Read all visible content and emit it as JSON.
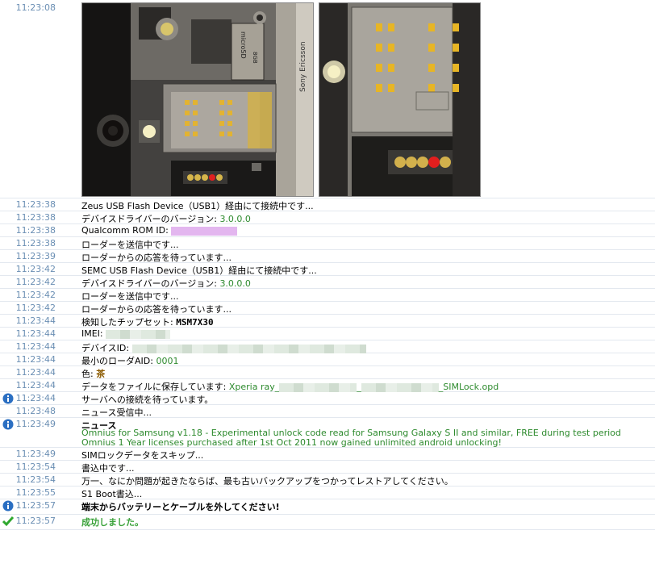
{
  "first_row": {
    "time": "11:23:08"
  },
  "photos": [
    {
      "name": "phone-sim-slot-photo"
    },
    {
      "name": "sim-slot-closeup-photo"
    }
  ],
  "photo_text": {
    "brand": "Sony Ericsson",
    "micro_sd": "microSD",
    "sd_size": "8GB"
  },
  "log": [
    {
      "time": "11:23:38",
      "text": "Zeus USB Flash Device（USB1）経由にて接続中です..."
    },
    {
      "time": "11:23:38",
      "label": "デバイスドライバーのバージョン: ",
      "value": "3.0.0.0"
    },
    {
      "time": "11:23:38",
      "label": "Qualcomm ROM ID: "
    },
    {
      "time": "11:23:38",
      "text": "ローダーを送信中です..."
    },
    {
      "time": "11:23:39",
      "text": "ローダーからの応答を待っています..."
    },
    {
      "time": "11:23:42",
      "text": "SEMC USB Flash Device（USB1）経由にて接続中です..."
    },
    {
      "time": "11:23:42",
      "label": "デバイスドライバーのバージョン: ",
      "value": "3.0.0.0"
    },
    {
      "time": "11:23:42",
      "text": "ローダーを送信中です..."
    },
    {
      "time": "11:23:42",
      "text": "ローダーからの応答を待っています..."
    },
    {
      "time": "11:23:44",
      "label": "検知したチップセット: ",
      "value": "MSM7X30"
    },
    {
      "time": "11:23:44",
      "label": "IMEI: "
    },
    {
      "time": "11:23:44",
      "label": "デバイスID: "
    },
    {
      "time": "11:23:44",
      "label": "最小のローダAID: ",
      "value": "0001"
    },
    {
      "time": "11:23:44",
      "label": "色: ",
      "value": "茶"
    },
    {
      "time": "11:23:44",
      "label": "データをファイルに保存しています: ",
      "value": "Xperia ray_",
      "value_end": "_SIMLock.opd"
    },
    {
      "time": "11:23:44",
      "text": "サーバへの接続を待っています。",
      "icon": "info-icon"
    },
    {
      "time": "11:23:48",
      "text": "ニュース受信中..."
    },
    {
      "time": "11:23:49",
      "title": "ニュース",
      "line1": "Omnius for Samsung v1.18 - Experimental unlock code read for Samsung Galaxy S II and similar, FREE during test period",
      "line2": "Omnius 1 Year licenses purchased after 1st Oct 2011 now gained unlimited android unlocking!",
      "icon": "info-icon"
    },
    {
      "time": "11:23:49",
      "text": "SIMロックデータをスキップ..."
    },
    {
      "time": "11:23:54",
      "text": "書込中です..."
    },
    {
      "time": "11:23:54",
      "text": "万一、なにか問題が起きたならば、最も古いバックアップをつかってレストアしてください。"
    },
    {
      "time": "11:23:55",
      "text": "S1 Boot書込..."
    },
    {
      "time": "11:23:57",
      "text": "端末からバッテリーとケーブルを外してください!",
      "icon": "info-icon"
    },
    {
      "time": "11:23:57",
      "text": "成功しました。",
      "icon": "checkmark-icon"
    }
  ],
  "colors": {
    "timestamp": "#6b8fb4",
    "value_green": "#2d8a2d",
    "success_green": "#3aa23a",
    "info_blue": "#2b6fc2"
  }
}
